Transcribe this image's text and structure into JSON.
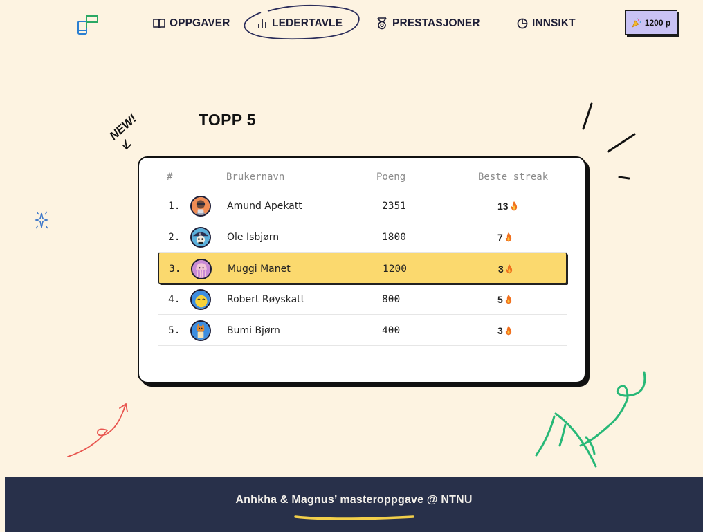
{
  "nav": {
    "items": [
      {
        "label": "OPPGAVER",
        "icon": "book-icon"
      },
      {
        "label": "LEDERTAVLE",
        "icon": "bar-chart-icon"
      },
      {
        "label": "PRESTASJONER",
        "icon": "medal-icon"
      },
      {
        "label": "INNSIKT",
        "icon": "pie-chart-icon"
      }
    ],
    "active": "LEDERTAVLE",
    "points_label": "1200 p"
  },
  "badge_new": "NEW!",
  "leaderboard": {
    "title": "TOPP 5",
    "columns": [
      "#",
      "Brukernavn",
      "Poeng",
      "Beste streak"
    ],
    "rows": [
      {
        "rank": "1.",
        "name": "Amund Apekatt",
        "points": "2351",
        "streak": "13",
        "avatar": "monkey-avatar"
      },
      {
        "rank": "2.",
        "name": "Ole Isbjørn",
        "points": "1800",
        "streak": "7",
        "avatar": "pirate-skull-avatar"
      },
      {
        "rank": "3.",
        "name": "Muggi Manet",
        "points": "1200",
        "streak": "3",
        "avatar": "jellyfish-avatar",
        "highlighted": true
      },
      {
        "rank": "4.",
        "name": "Robert Røyskatt",
        "points": "800",
        "streak": "5",
        "avatar": "chick-avatar"
      },
      {
        "rank": "5.",
        "name": "Bumi Bjørn",
        "points": "400",
        "streak": "3",
        "avatar": "fox-avatar"
      }
    ]
  },
  "footer": {
    "text": "Anhkha & Magnus’ masteroppgave @ NTNU"
  },
  "colors": {
    "background": "#fdf3e1",
    "highlight": "#fbd96e",
    "points_button": "#c9c2f4",
    "footer": "#28304a",
    "footer_underline": "#f2cf4a",
    "flame": "#f0701e"
  }
}
